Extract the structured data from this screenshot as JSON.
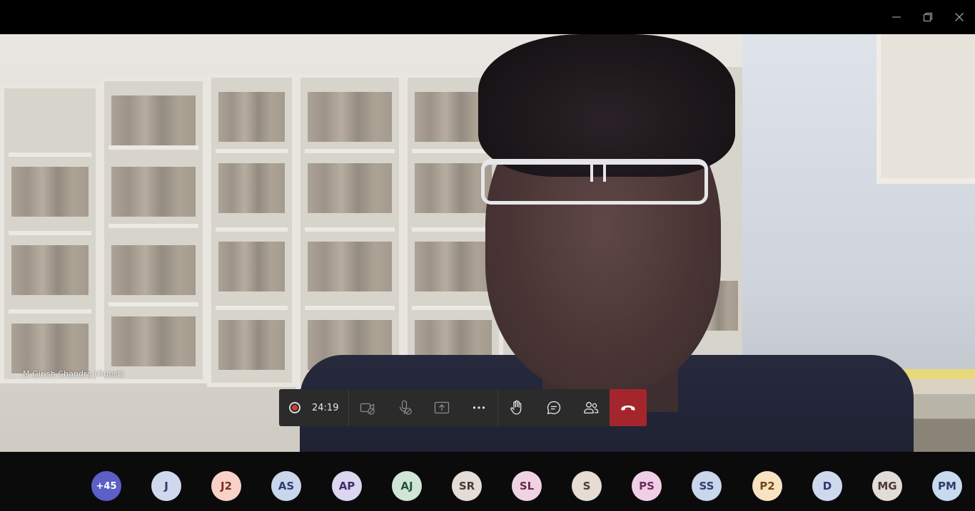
{
  "window": {
    "controls": [
      {
        "name": "minimize",
        "icon": "minimize-icon"
      },
      {
        "name": "restore",
        "icon": "restore-icon"
      },
      {
        "name": "close",
        "icon": "close-icon"
      }
    ]
  },
  "video": {
    "participant_name": "M Girish Chandra (Guest)"
  },
  "callbar": {
    "recording_icon": "record-icon",
    "timer": "24:19",
    "buttons": [
      {
        "name": "camera-off",
        "icon": "camera-off-icon"
      },
      {
        "name": "mic-off",
        "icon": "mic-off-icon"
      },
      {
        "name": "share",
        "icon": "share-screen-icon"
      },
      {
        "name": "more",
        "icon": "more-icon"
      },
      {
        "name": "raise-hand",
        "icon": "hand-icon"
      },
      {
        "name": "chat",
        "icon": "chat-icon"
      },
      {
        "name": "participants",
        "icon": "participants-icon"
      }
    ],
    "hangup_icon": "hangup-icon",
    "hangup_color": "#a4262c"
  },
  "participants": [
    {
      "initials": "+45",
      "color": "#5b5fc7",
      "text_color": "#ffffff"
    },
    {
      "initials": "J",
      "color": "#cfd8ee",
      "text_color": "#2e3a6e"
    },
    {
      "initials": "J2",
      "color": "#f8d1c9",
      "text_color": "#7a2e24"
    },
    {
      "initials": "AS",
      "color": "#c9d6ec",
      "text_color": "#2c3f6e"
    },
    {
      "initials": "AP",
      "color": "#dcd6f0",
      "text_color": "#3d2f6e"
    },
    {
      "initials": "AJ",
      "color": "#cfe5d6",
      "text_color": "#24553a"
    },
    {
      "initials": "SR",
      "color": "#e4dcd6",
      "text_color": "#4e3b32"
    },
    {
      "initials": "SL",
      "color": "#f0d3e2",
      "text_color": "#6b2d4f"
    },
    {
      "initials": "S",
      "color": "#e6dcd4",
      "text_color": "#4e3b32"
    },
    {
      "initials": "PS",
      "color": "#f0cfe6",
      "text_color": "#6b2d5a"
    },
    {
      "initials": "SS",
      "color": "#c9d6ec",
      "text_color": "#2c3f6e"
    },
    {
      "initials": "P2",
      "color": "#f8e2c2",
      "text_color": "#6e4a1a"
    },
    {
      "initials": "D",
      "color": "#cfd9ee",
      "text_color": "#2e3a6e"
    },
    {
      "initials": "MG",
      "color": "#e2dcd6",
      "text_color": "#4e3b32"
    },
    {
      "initials": "PM",
      "color": "#c9d9ee",
      "text_color": "#2c3f6e"
    }
  ]
}
